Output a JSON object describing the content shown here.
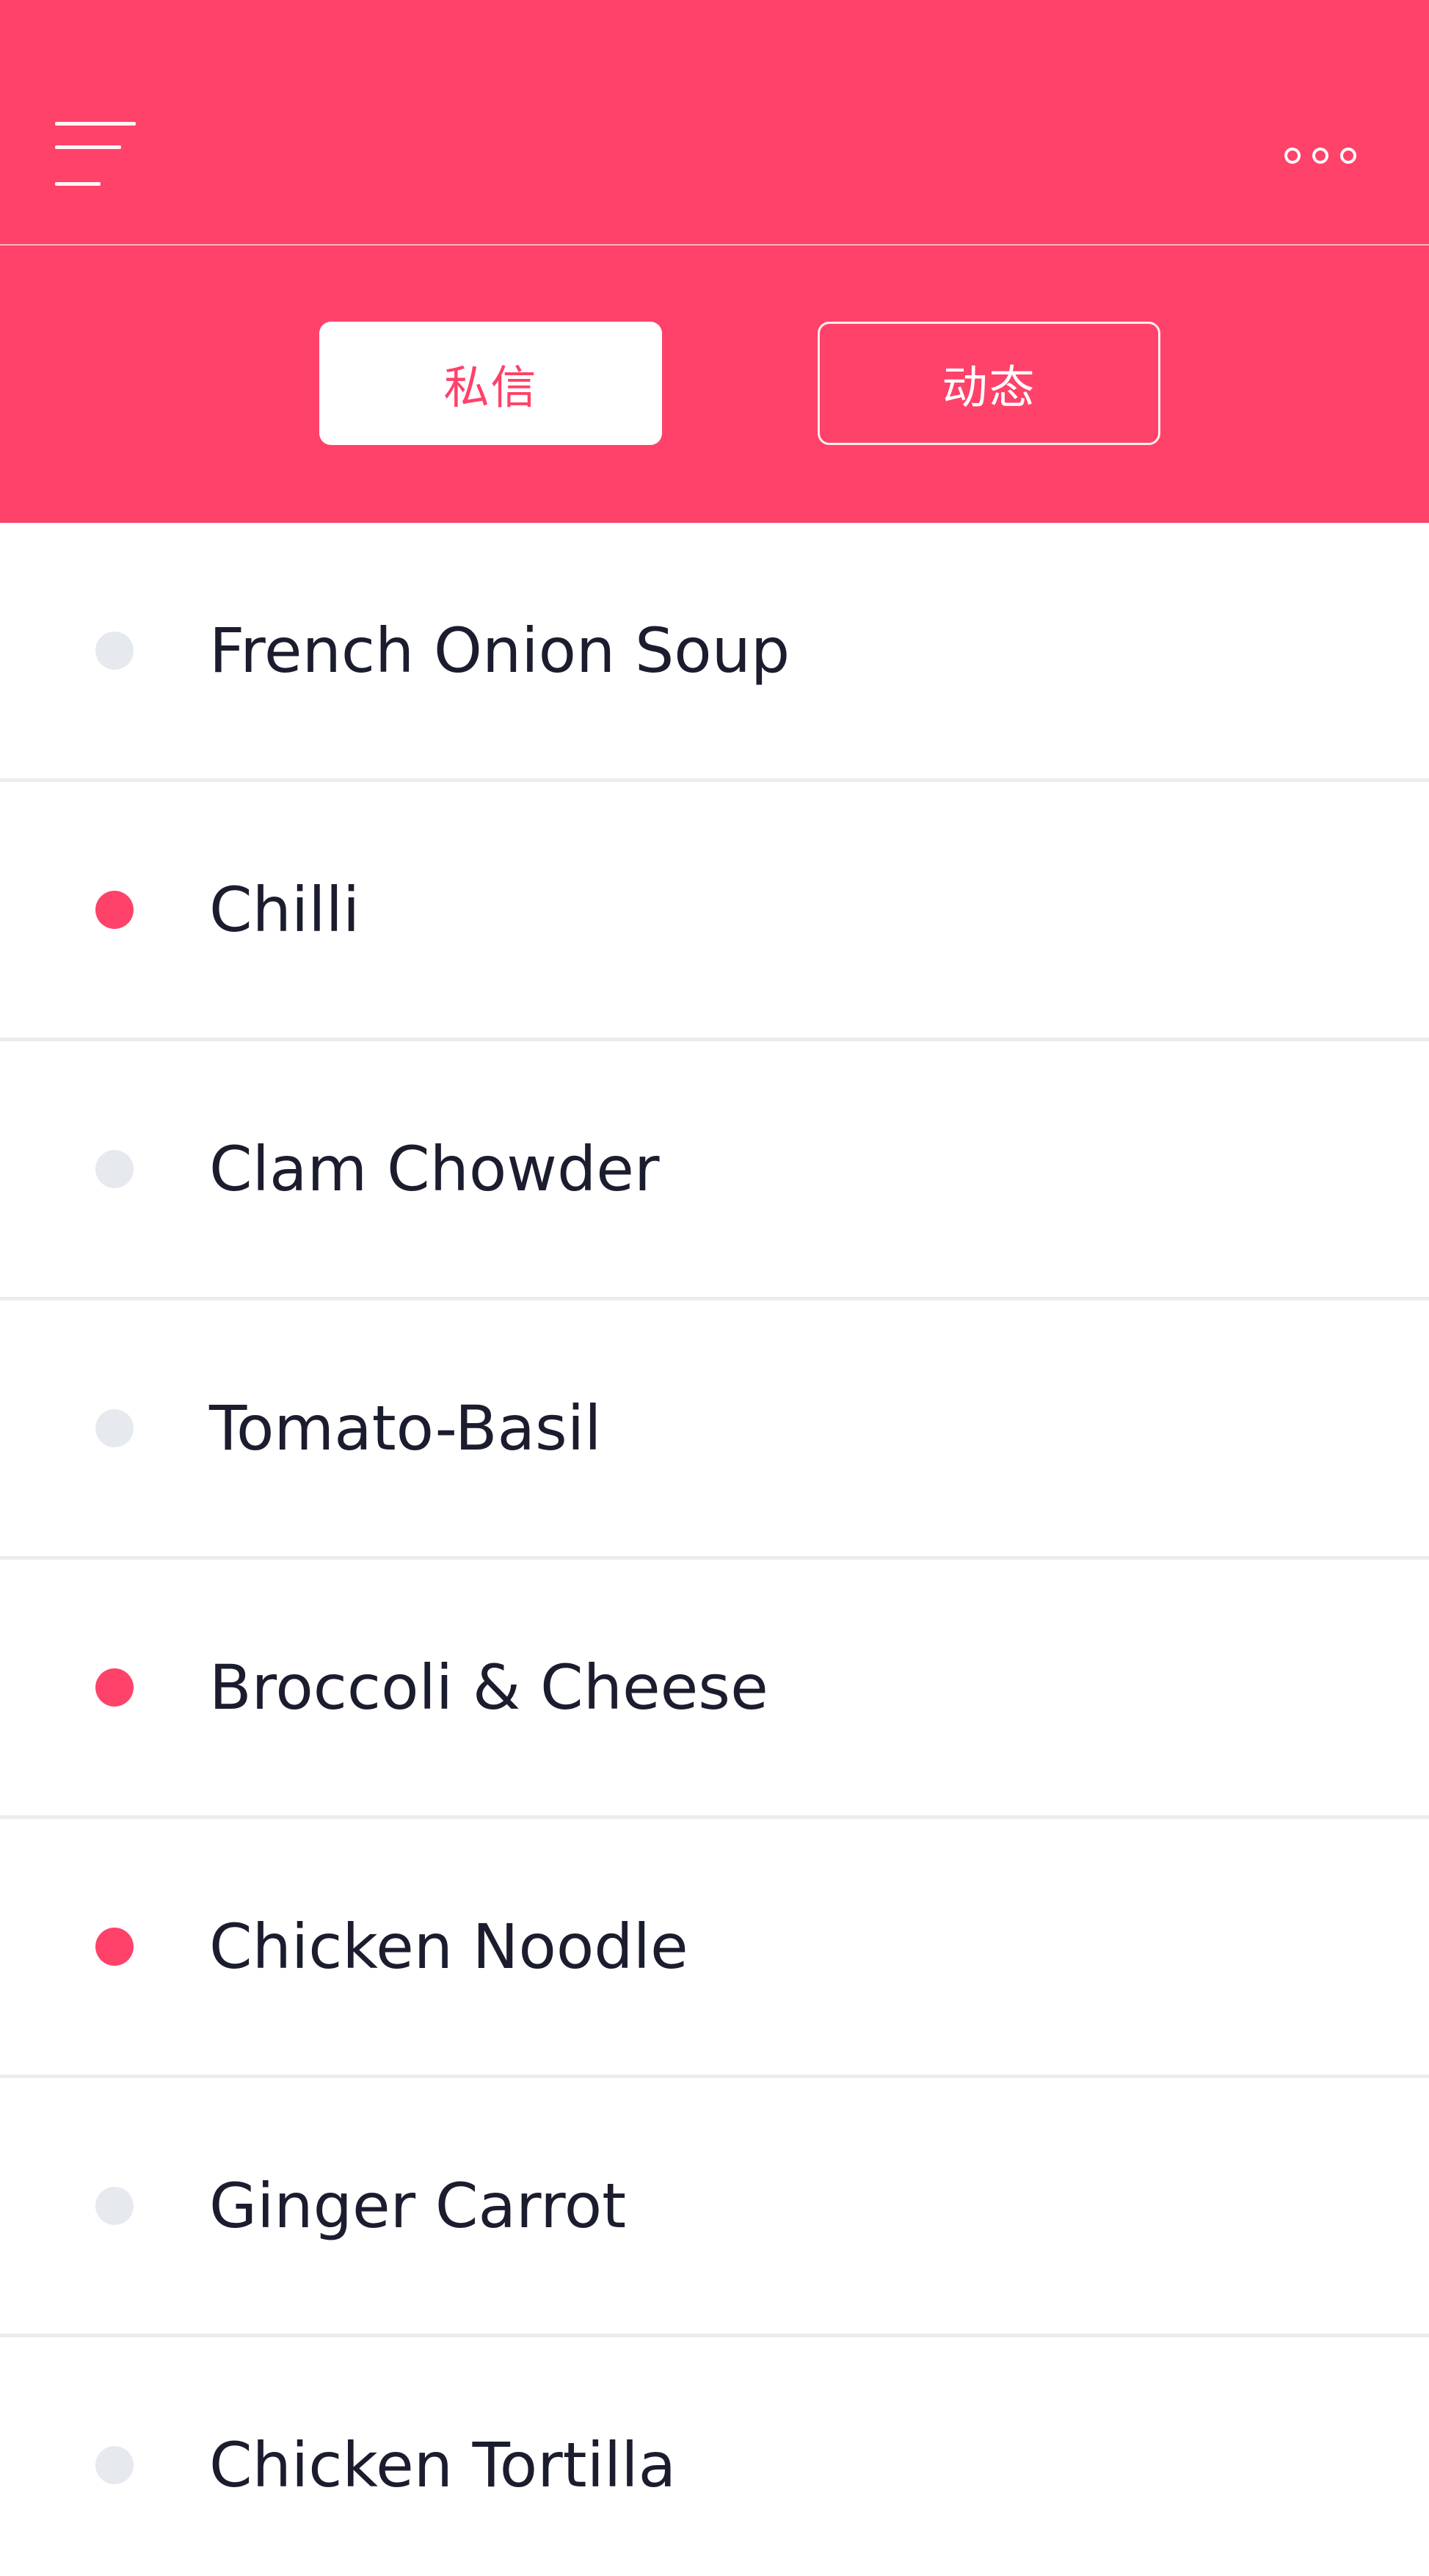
{
  "colors": {
    "accent": "#ff4269",
    "unread_dot": "#ff4269",
    "read_dot": "#e6e9ee",
    "text": "#1b1d2e",
    "divider": "#ececee"
  },
  "header": {
    "menu_icon": "hamburger-menu-icon",
    "more_icon": "more-options-icon"
  },
  "tabs": [
    {
      "label": "私信",
      "active": true
    },
    {
      "label": "动态",
      "active": false
    }
  ],
  "list": {
    "items": [
      {
        "label": "French Onion Soup",
        "unread": false
      },
      {
        "label": "Chilli",
        "unread": true
      },
      {
        "label": "Clam Chowder",
        "unread": false
      },
      {
        "label": "Tomato-Basil",
        "unread": false
      },
      {
        "label": "Broccoli & Cheese",
        "unread": true
      },
      {
        "label": "Chicken Noodle",
        "unread": true
      },
      {
        "label": "Ginger Carrot",
        "unread": false
      },
      {
        "label": "Chicken Tortilla",
        "unread": false
      }
    ]
  }
}
